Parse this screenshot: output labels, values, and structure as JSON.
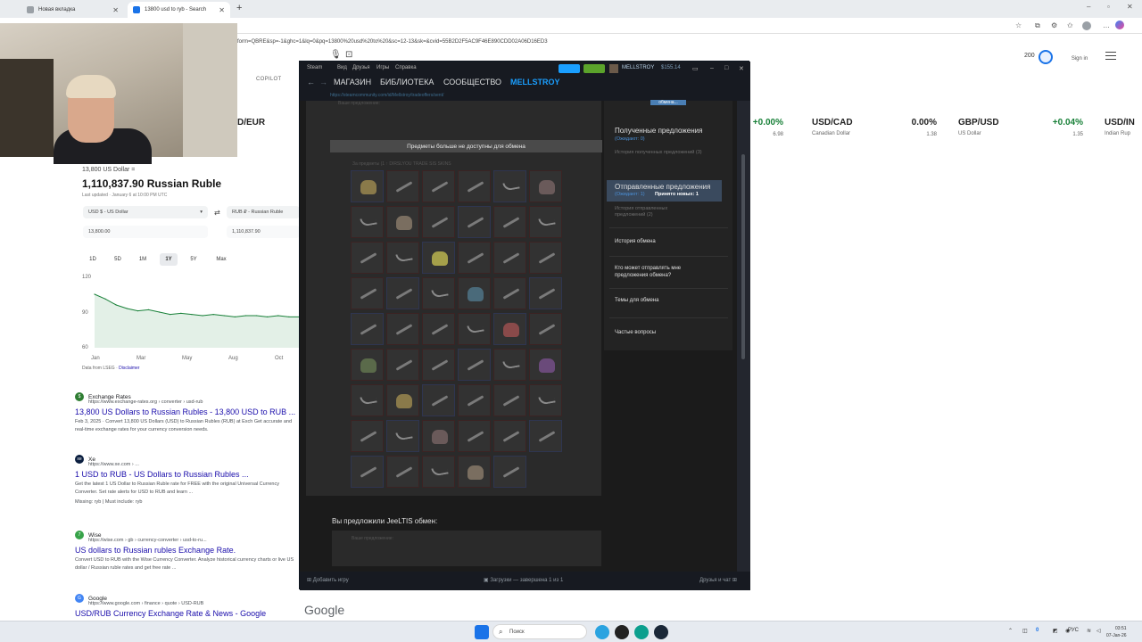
{
  "browser": {
    "tabs": [
      {
        "label": "Новая вкладка"
      },
      {
        "label": "13800 usd to ryb - Search"
      }
    ],
    "url": "form=QBRE&sp=-1&ghc=1&lq=0&pq=13800%20usd%20to%20&sc=12-13&sk=&cvid=55B2D2F5AC9F46E890CDD02A06D16ED3",
    "new_tab": "+"
  },
  "bing": {
    "copilot": "COPILOT",
    "points": "200",
    "signin": "Sign in",
    "tickers": [
      {
        "pair": "D/EUR",
        "name": "",
        "change": "",
        "value": ""
      },
      {
        "pair": "",
        "name": "",
        "change": "+0.00%",
        "value": "6.98"
      },
      {
        "pair": "USD/CAD",
        "name": "Canadian Dollar",
        "change": "0.00%",
        "value": "1.38"
      },
      {
        "pair": "GBP/USD",
        "name": "US Dollar",
        "change": "+0.04%",
        "value": "1.35"
      },
      {
        "pair": "USD/IN",
        "name": "Indian Rup",
        "change": "",
        "value": ""
      }
    ],
    "converter": {
      "from_amount_label": "13,800 US Dollar =",
      "result": "1,110,837.90 Russian Ruble",
      "updated": "Last updated · January 6 at 10:00 PM UTC",
      "from_currency": "USD $ - US Dollar",
      "to_currency": "RUB ₽ - Russian Ruble",
      "from_value": "13,800.00",
      "to_value": "1,110,837.90",
      "swap_icon": "⇄",
      "ranges": [
        "1D",
        "5D",
        "1M",
        "1Y",
        "5Y",
        "Max"
      ],
      "active_range": "1Y",
      "y_ticks": [
        "120",
        "90",
        "60"
      ],
      "x_ticks": [
        "Jan",
        "Mar",
        "May",
        "Aug",
        "Oct"
      ],
      "data_source": "Data from LSEG · ",
      "disclaimer": "Disclaimer"
    },
    "results": [
      {
        "site": "Exchange Rates",
        "url": "https://www.exchange-rates.org › converter › usd-rub",
        "title": "13,800 US Dollars to Russian Rubles - 13,800 USD to RUB ...",
        "snippet": "Feb 3, 2025 · Convert 13,800 US Dollars (USD) to Russian Rubles (RUB) at Exch Get accurate and real-time exchange rates for your currency conversion needs.",
        "icon_color": "#2e7d32",
        "icon": "$"
      },
      {
        "site": "Xe",
        "url": "https://www.xe.com › ...",
        "title": "1 USD to RUB - US Dollars to Russian Rubles ...",
        "snippet": "Get the latest 1 US Dollar to Russian Ruble rate for FREE with the original Universal Currency Converter. Set rate alerts for USD to RUB and learn ...",
        "missing": "Missing: ryb | Must include: ryb",
        "icon_color": "#0a1e3f",
        "icon": "xe"
      },
      {
        "site": "Wise",
        "url": "https://wise.com › gb › currency-converter › usd-to-ru...",
        "title": "US dollars to Russian rubles Exchange Rate.",
        "snippet": "Convert USD to RUB with the Wise Currency Converter. Analyze historical currency charts or live US dollar / Russian ruble rates and get free rate ...",
        "icon_color": "#37a349",
        "icon": "7"
      },
      {
        "site": "Google",
        "url": "https://www.google.com › finance › quote › USD-RUB",
        "title": "USD/RUB Currency Exchange Rate & News - Google",
        "snippet": "",
        "icon_color": "#4285f4",
        "icon": "G"
      }
    ],
    "google_logo": "Google"
  },
  "chart_data": {
    "type": "area",
    "title": "",
    "xlabel": "",
    "ylabel": "",
    "ylim": [
      60,
      120
    ],
    "x_ticks": [
      "Jan",
      "Mar",
      "May",
      "Aug",
      "Oct"
    ],
    "series": [
      {
        "values": [
          105,
          101,
          96,
          93,
          91,
          92,
          90,
          88,
          89,
          88,
          87,
          88,
          87,
          86,
          87,
          87,
          86,
          87,
          86,
          86
        ]
      }
    ],
    "color": "#188038"
  },
  "steam": {
    "menu": [
      "Steam",
      "Вид",
      "Друзья",
      "Игры",
      "Справка"
    ],
    "account": "MELLSTROY",
    "balance": "$155.14",
    "nav": [
      "МАГАЗИН",
      "БИБЛИОТЕКА",
      "СООБЩЕСТВО",
      "MELLSTROY"
    ],
    "url": "https://steamcommunity.com/id/Mellstroy/tradeoffers/sent/",
    "offer_header": "Ваше предложение:",
    "unavailable": "Предметы больше не доступны для обмена",
    "for_items": "За предметы (1 ↑ DIRSLYOU TRADE SIS SKINS",
    "offered_to": "Вы предложили JeeLTIS обмен:",
    "your_offer": "Ваше предложение:",
    "sidebar": {
      "top_stub": "обмена...",
      "received": "Полученные предложения",
      "received_wait": "(Ожидают: 0)",
      "received_history": "История полученных предложений (3)",
      "sent": "Отправленные предложения",
      "sent_wait": "(Ожидают: 1)",
      "sent_new": "Принято новых: 1",
      "sent_history": "История отправленных предложений (2)",
      "history": "История обмена",
      "who": "Кто может отправлять мне предложения обмена?",
      "topics": "Темы для обмена",
      "faq": "Частые вопросы"
    },
    "footer": {
      "add_game": "Добавить игру",
      "downloads": "Загрузки — завершена 1 из 1",
      "friends": "Друзья и чат"
    }
  },
  "taskbar": {
    "search": "Поиск",
    "lang": "РУС",
    "time": "03:51",
    "date": "07-Jan-26"
  }
}
